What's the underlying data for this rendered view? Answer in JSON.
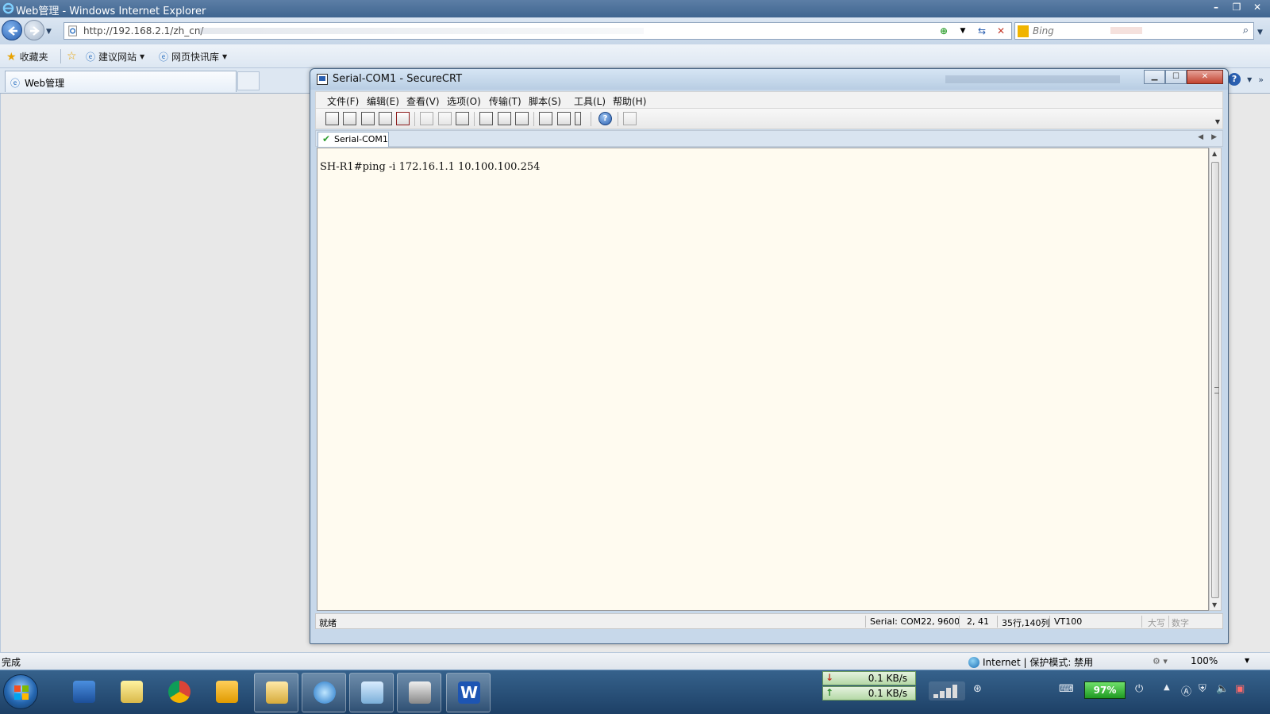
{
  "ie": {
    "title": "Web管理 - Windows Internet Explorer",
    "address": "http://192.168.2.1/zh_cn/",
    "search_placeholder": "Bing",
    "favorites_label": "收藏夹",
    "fav_items": [
      "建议网站",
      "网页快讯库"
    ],
    "tab_title": "Web管理",
    "status_text": "完成",
    "zone_text": "Internet | 保护模式: 禁用",
    "zoom": "100%"
  },
  "crt": {
    "title": "Serial-COM1 - SecureCRT",
    "menu": [
      "文件(F)",
      "编辑(E)",
      "查看(V)",
      "选项(O)",
      "传输(T)",
      "脚本(S)",
      "工具(L)",
      "帮助(H)"
    ],
    "tab_label": "Serial-COM1",
    "terminal_line": "SH-R1#ping -i 172.16.1.1 10.100.100.254",
    "status": {
      "ready": "就绪",
      "serial": "Serial: COM22, 9600",
      "cursor": "2, 41",
      "size": "35行,140列",
      "emulation": "VT100",
      "caps": "大写",
      "num": "数字"
    }
  },
  "taskbar": {
    "download_speed": "0.1 KB/s",
    "upload_speed": "0.1 KB/s",
    "battery": "97%"
  },
  "colors": {
    "terminal_bg": "#fffbf0",
    "ie_title": "#4a6e98",
    "taskbar": "#284f78"
  }
}
